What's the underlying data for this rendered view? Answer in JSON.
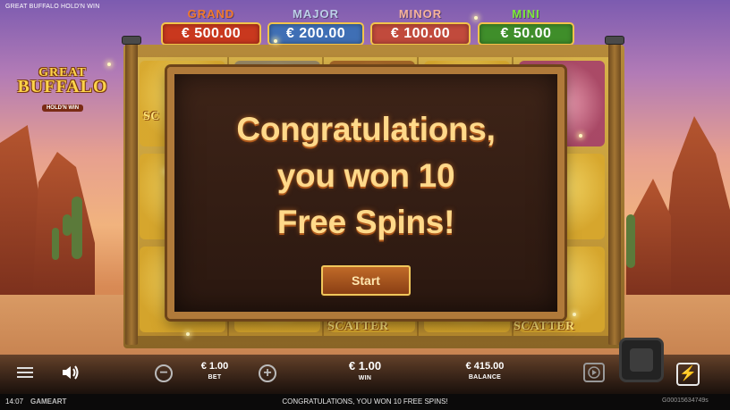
{
  "game": {
    "title": "GREAT BUFFALO HOLD'N WIN",
    "logo_line1": "GREAT",
    "logo_line2": "BUFFALO",
    "logo_line3": "HOLD'N WIN"
  },
  "jackpots": [
    {
      "label": "GRAND",
      "value": "€ 500.00",
      "label_color": "#f27a2a",
      "box_color": "#c9381e"
    },
    {
      "label": "MAJOR",
      "value": "€ 200.00",
      "label_color": "#bcd0e8",
      "box_color": "#3f6fb5"
    },
    {
      "label": "MINOR",
      "value": "€ 100.00",
      "label_color": "#f6b39a",
      "box_color": "#c14a3c"
    },
    {
      "label": "MINI",
      "value": "€ 50.00",
      "label_color": "#7dea3a",
      "box_color": "#3f8e2a"
    }
  ],
  "reels": {
    "scatter_labels": [
      "SC",
      "SCATTER",
      "SCATTER"
    ]
  },
  "modal": {
    "message": "Congratulations,\nyou won 10\nFree Spins!",
    "start_label": "Start"
  },
  "controls": {
    "bet_value": "€ 1.00",
    "bet_label": "BET",
    "win_value": "€ 1.00",
    "win_label": "WIN",
    "balance_value": "€ 415.00",
    "balance_label": "BALANCE",
    "minus_symbol": "−",
    "plus_symbol": "+",
    "turbo_symbol": "⚡"
  },
  "status": {
    "time": "14:07",
    "provider": "GAMEART",
    "message": "CONGRATULATIONS, YOU WON 10 FREE SPINS!",
    "round_id": "G00015634749s"
  },
  "icons": {
    "menu": "menu-icon",
    "sound": "speaker-icon",
    "autoplay": "autoplay-icon",
    "turbo": "lightning-icon"
  }
}
